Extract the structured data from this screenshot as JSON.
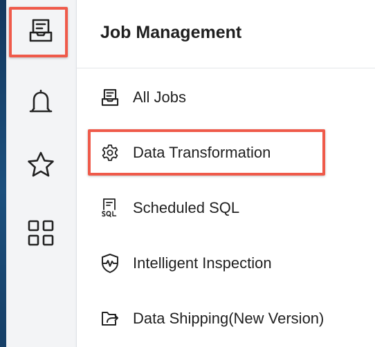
{
  "panel": {
    "title": "Job Management",
    "items": [
      {
        "label": "All Jobs",
        "icon": "job-list-icon"
      },
      {
        "label": "Data Transformation",
        "icon": "gear-icon"
      },
      {
        "label": "Scheduled SQL",
        "icon": "sql-schedule-icon"
      },
      {
        "label": "Intelligent Inspection",
        "icon": "shield-pulse-icon"
      },
      {
        "label": "Data Shipping(New Version)",
        "icon": "folder-export-icon"
      }
    ]
  },
  "sidebar": {
    "items": [
      {
        "icon": "job-list-icon",
        "active": true
      },
      {
        "icon": "bell-icon"
      },
      {
        "icon": "star-icon"
      },
      {
        "icon": "grid-icon"
      }
    ]
  },
  "colors": {
    "highlight_border": "#ef5a4a",
    "icon_stroke": "#222222",
    "text": "#1f1f1f"
  }
}
